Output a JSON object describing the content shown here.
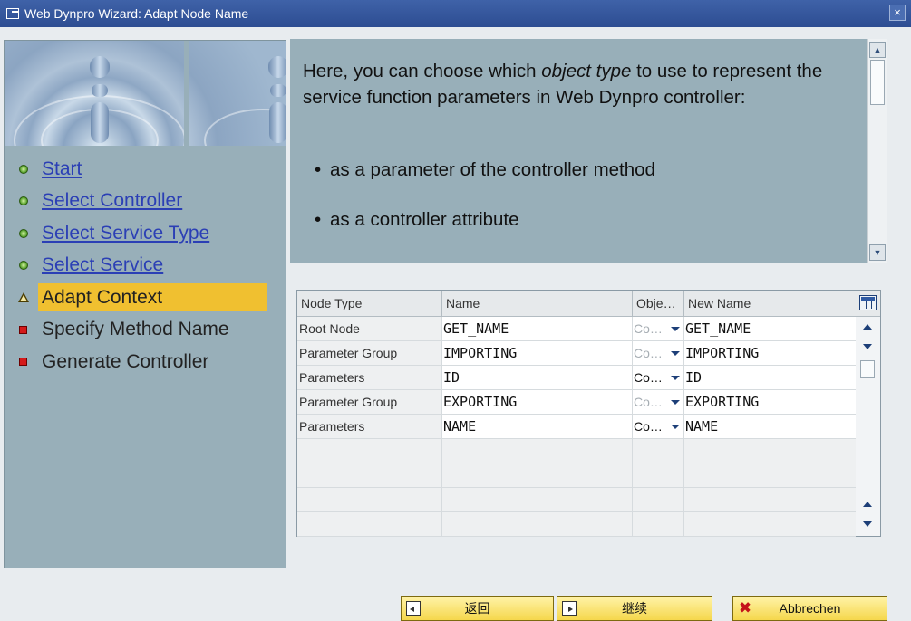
{
  "window": {
    "title": "Web Dynpro Wizard: Adapt Node Name",
    "close_glyph": "×"
  },
  "steps": [
    {
      "label": "Start",
      "state": "done"
    },
    {
      "label": "Select Controller",
      "state": "done"
    },
    {
      "label": "Select Service Type",
      "state": "done"
    },
    {
      "label": "Select Service",
      "state": "done"
    },
    {
      "label": "Adapt Context",
      "state": "current"
    },
    {
      "label": "Specify Method Name",
      "state": "todo"
    },
    {
      "label": "Generate Controller",
      "state": "todo"
    }
  ],
  "description": {
    "intro_before": "Here, you can choose which ",
    "intro_em": "object type",
    "intro_after": " to use to represent the service function parameters in Web Dynpro controller:",
    "bullets": [
      "as a parameter of the controller method",
      "as a controller attribute"
    ]
  },
  "table": {
    "columns": [
      "Node Type",
      "Name",
      "Obje…",
      "New Name"
    ],
    "rows": [
      {
        "node_type": "Root Node",
        "name": "GET_NAME",
        "object_type": "Co…",
        "new_name": "GET_NAME"
      },
      {
        "node_type": "Parameter Group",
        "name": "IMPORTING",
        "object_type": "Co…",
        "new_name": "IMPORTING"
      },
      {
        "node_type": "Parameters",
        "name": "ID",
        "object_type": "Co…",
        "new_name": "ID"
      },
      {
        "node_type": "Parameter Group",
        "name": "EXPORTING",
        "object_type": "Co…",
        "new_name": "EXPORTING"
      },
      {
        "node_type": "Parameters",
        "name": "NAME",
        "object_type": "Co…",
        "new_name": "NAME"
      }
    ]
  },
  "buttons": {
    "back": "返回",
    "continue": "继续",
    "cancel": "Abbrechen"
  },
  "icons": {
    "done_step": "green-circle-icon",
    "current_step": "warning-triangle-icon",
    "todo_step": "red-square-icon",
    "back": "back-arrow-icon",
    "continue": "forward-arrow-icon",
    "cancel": "red-x-icon"
  },
  "colors": {
    "titlebar": "#2d4d92",
    "panel": "#98afb9",
    "highlight": "#f0c030",
    "link": "#2b3fb5",
    "button": "#f5d74c"
  }
}
